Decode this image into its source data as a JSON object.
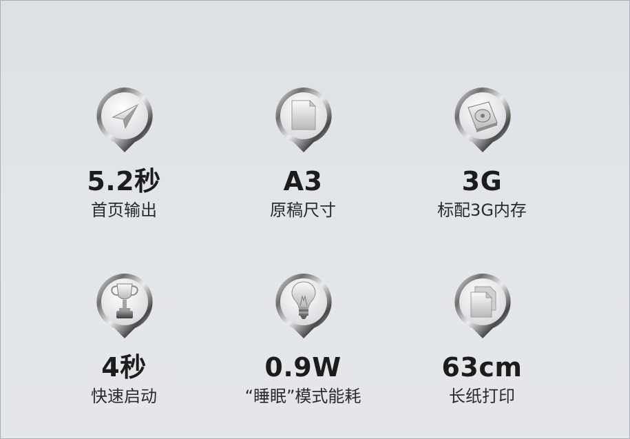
{
  "features": [
    {
      "value": "5.2秒",
      "label": "首页输出",
      "icon": "paper-plane-icon"
    },
    {
      "value": "A3",
      "label": "原稿尺寸",
      "icon": "document-icon"
    },
    {
      "value": "3G",
      "label": "标配3G内存",
      "icon": "hard-drive-icon"
    },
    {
      "value": "4秒",
      "label": "快速启动",
      "icon": "trophy-icon"
    },
    {
      "value": "0.9W",
      "label": "“睡眠”模式能耗",
      "icon": "light-bulb-icon"
    },
    {
      "value": "63cm",
      "label": "长纸打印",
      "icon": "long-paper-icon"
    }
  ]
}
